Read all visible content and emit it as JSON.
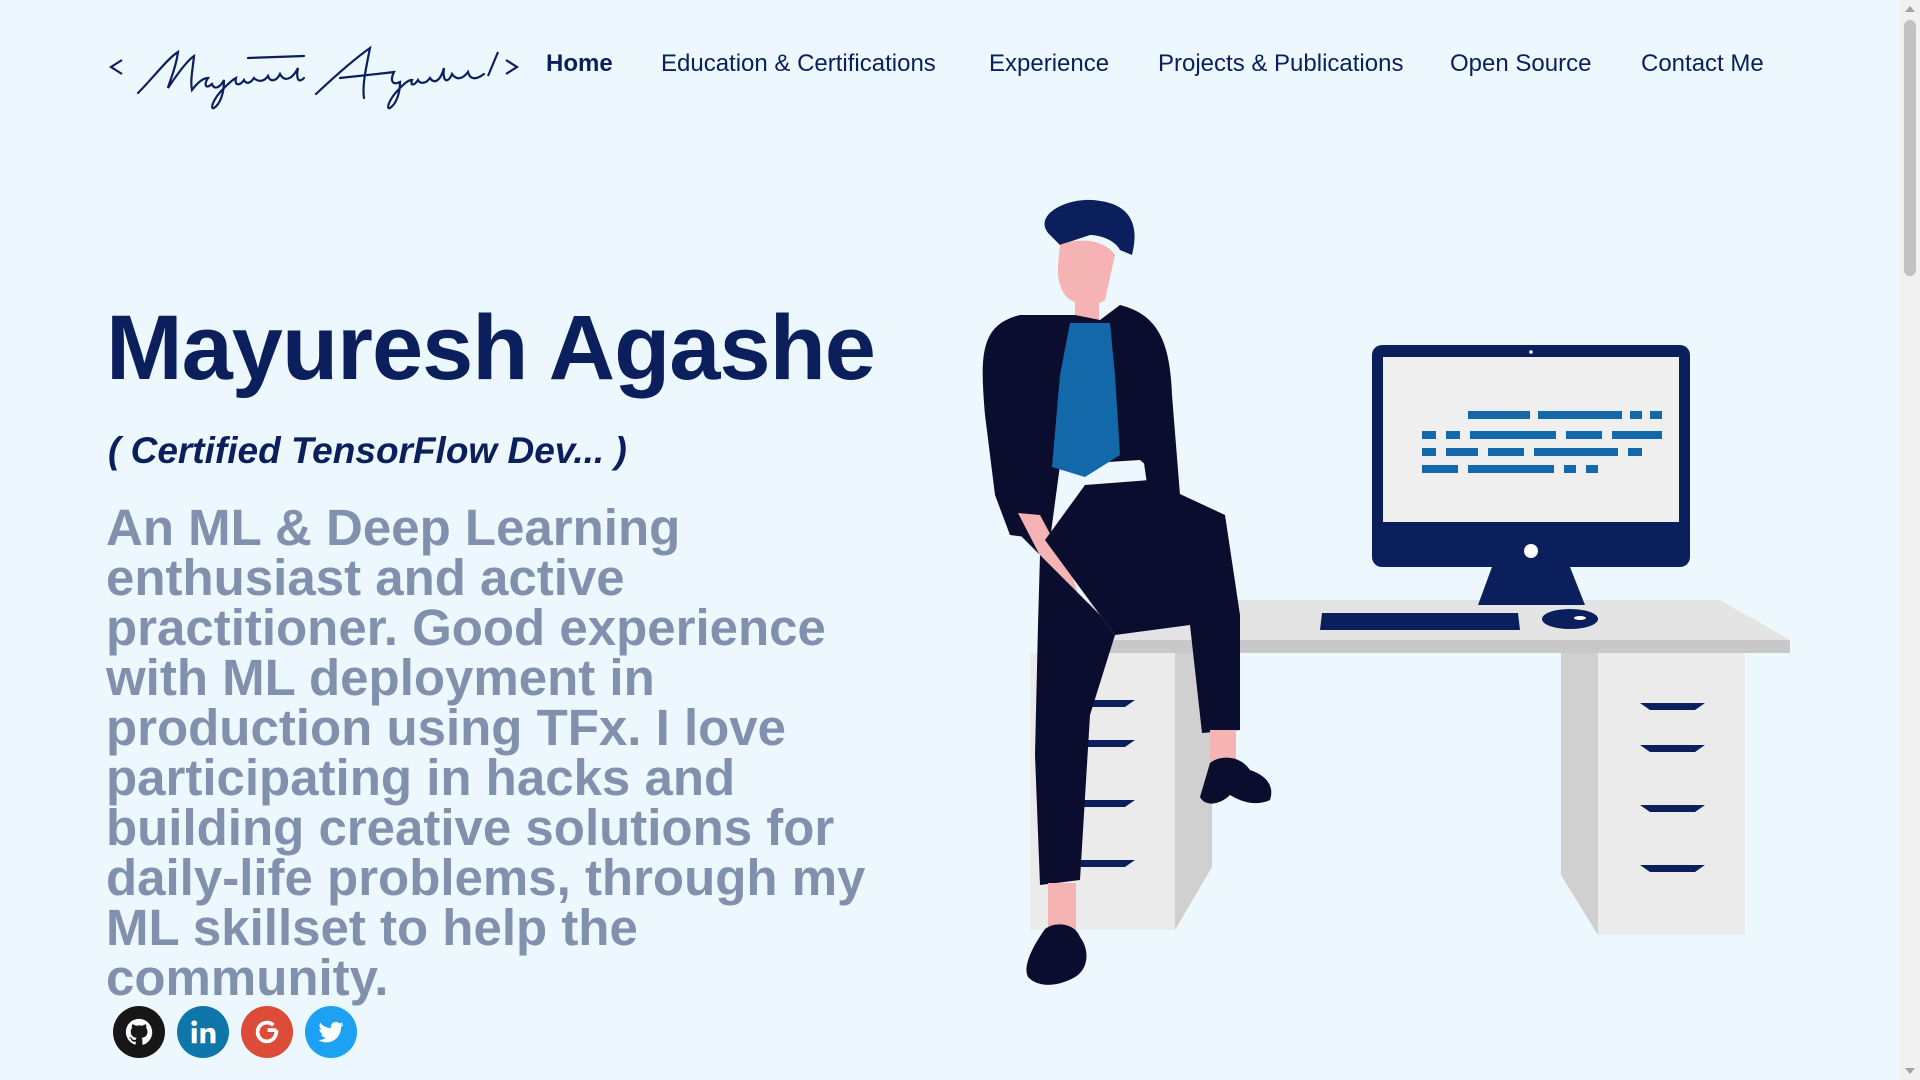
{
  "header": {
    "logo_text": "< Mayuresh Agashe />",
    "nav": [
      {
        "label": "Home"
      },
      {
        "label": "Education & Certifications"
      },
      {
        "label": "Experience"
      },
      {
        "label": "Projects & Publications"
      },
      {
        "label": "Open Source"
      },
      {
        "label": "Contact Me"
      }
    ]
  },
  "hero": {
    "name": "Mayuresh Agashe",
    "subtitle": "( Certified TensorFlow Dev... )",
    "description": "An ML & Deep Learning enthusiast and active practitioner. Good experience with ML deployment in production using TFx. I love participating in hacks and building creative solutions for daily-life problems, through my ML skillset to help the community."
  },
  "social": [
    {
      "icon": "github-icon",
      "color": "#181717"
    },
    {
      "icon": "linkedin-icon",
      "color": "#0e76a8"
    },
    {
      "icon": "google-icon",
      "color": "#dd4b39"
    },
    {
      "icon": "twitter-icon",
      "color": "#1da1f2"
    }
  ],
  "colors": {
    "background": "#edf7fe",
    "primary": "#0a1f5c",
    "muted_text": "#8090ad",
    "accent": "#1268a8"
  }
}
